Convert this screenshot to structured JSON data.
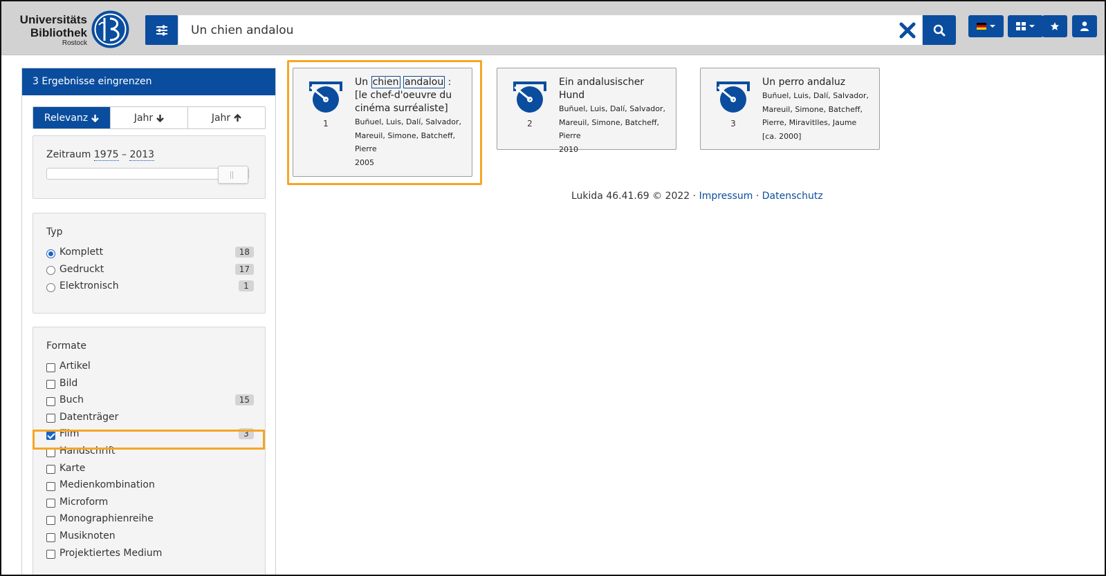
{
  "search": {
    "value": "Un chien andalou"
  },
  "logo": {
    "line1": "Universitäts",
    "line2": "Bibliothek",
    "line3": "Rostock"
  },
  "sidebar": {
    "header": "3 Ergebnisse eingrenzen",
    "sort": {
      "relevanz": "Relevanz",
      "jahr_desc": "Jahr",
      "jahr_asc": "Jahr"
    },
    "range": {
      "label": "Zeitraum",
      "from": "1975",
      "sep": "–",
      "to": "2013",
      "slider_value": 1.0
    },
    "typ": {
      "title": "Typ",
      "options": [
        {
          "label": "Komplett",
          "count": "18",
          "selected": true
        },
        {
          "label": "Gedruckt",
          "count": "17",
          "selected": false
        },
        {
          "label": "Elektronisch",
          "count": "1",
          "selected": false
        }
      ]
    },
    "formate": {
      "title": "Formate",
      "options": [
        {
          "label": "Artikel",
          "count": ""
        },
        {
          "label": "Bild",
          "count": ""
        },
        {
          "label": "Buch",
          "count": "15"
        },
        {
          "label": "Datenträger",
          "count": ""
        },
        {
          "label": "Film",
          "count": "3",
          "checked": true
        },
        {
          "label": "Handschrift",
          "count": ""
        },
        {
          "label": "Karte",
          "count": ""
        },
        {
          "label": "Medienkombination",
          "count": ""
        },
        {
          "label": "Microform",
          "count": ""
        },
        {
          "label": "Monographienreihe",
          "count": ""
        },
        {
          "label": "Musiknoten",
          "count": ""
        },
        {
          "label": "Projektiertes Medium",
          "count": ""
        }
      ]
    }
  },
  "results": [
    {
      "num": "1",
      "title_pre": "Un ",
      "title_hl1": "chien",
      "title_hl2": "andalou",
      "title_post": " : [le chef-d'oeuvre du cinéma surréaliste]",
      "authors": "Buñuel, Luis, Dalí, Salvador, Mareuil, Simone, Batcheff, Pierre",
      "year": "2005",
      "icon": "film-reel-icon"
    },
    {
      "num": "2",
      "title": "Ein andalusischer Hund",
      "authors": "Buñuel, Luis, Dalí, Salvador, Mareuil, Simone, Batcheff, Pierre",
      "year": "2010",
      "icon": "film-reel-icon"
    },
    {
      "num": "3",
      "title": "Un perro andaluz",
      "authors": "Buñuel, Luis, Dalí, Salvador, Mareuil, Simone, Batcheff, Pierre, Miravitlles, Jaume",
      "year": "[ca. 2000]",
      "icon": "film-reel-icon"
    }
  ],
  "footer": {
    "text": "Lukida 46.41.69 © 2022",
    "dot1": "·",
    "impressum": "Impressum",
    "dot2": "·",
    "datenschutz": "Datenschutz"
  },
  "colors": {
    "primary": "#0a4d9e",
    "highlight": "#f5a623",
    "header_bg": "#d2d2d2"
  }
}
